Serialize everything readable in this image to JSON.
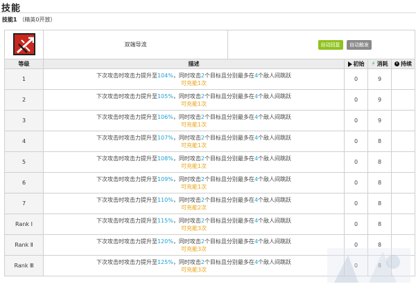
{
  "page": {
    "title": "技能",
    "skill_tag": "技能1",
    "skill_unlock": "（精英0开放）"
  },
  "skill": {
    "name": "双端导流",
    "icon": "skill-icon-red-arrows",
    "badge_recovery": "自动回复",
    "badge_trigger": "自动触发",
    "badge_recovery_color": "#8fc31f",
    "badge_trigger_color": "#8a8a8a"
  },
  "columns": {
    "level": "等级",
    "description": "描述",
    "initial": "初始",
    "cost": "消耗",
    "duration": "持续"
  },
  "rows": [
    {
      "level": "1",
      "pre": "下次攻击时攻击力提升至",
      "atk": "104%",
      "mid": "，同时攻击",
      "targets": "2",
      "mid2": "个目标且分别最多在",
      "enemies": "4",
      "post": "个敌人间跳跃",
      "charge": "可充能1次",
      "initial": "0",
      "cost": "9",
      "duration": ""
    },
    {
      "level": "2",
      "pre": "下次攻击时攻击力提升至",
      "atk": "105%",
      "mid": "，同时攻击",
      "targets": "2",
      "mid2": "个目标且分别最多在",
      "enemies": "4",
      "post": "个敌人间跳跃",
      "charge": "可充能1次",
      "initial": "0",
      "cost": "9",
      "duration": ""
    },
    {
      "level": "3",
      "pre": "下次攻击时攻击力提升至",
      "atk": "106%",
      "mid": "，同时攻击",
      "targets": "2",
      "mid2": "个目标且分别最多在",
      "enemies": "4",
      "post": "个敌人间跳跃",
      "charge": "可充能1次",
      "initial": "0",
      "cost": "9",
      "duration": ""
    },
    {
      "level": "4",
      "pre": "下次攻击时攻击力提升至",
      "atk": "107%",
      "mid": "，同时攻击",
      "targets": "2",
      "mid2": "个目标且分别最多在",
      "enemies": "4",
      "post": "个敌人间跳跃",
      "charge": "可充能1次",
      "initial": "0",
      "cost": "8",
      "duration": ""
    },
    {
      "level": "5",
      "pre": "下次攻击时攻击力提升至",
      "atk": "108%",
      "mid": "，同时攻击",
      "targets": "2",
      "mid2": "个目标且分别最多在",
      "enemies": "4",
      "post": "个敌人间跳跃",
      "charge": "可充能1次",
      "initial": "0",
      "cost": "8",
      "duration": ""
    },
    {
      "level": "6",
      "pre": "下次攻击时攻击力提升至",
      "atk": "109%",
      "mid": "，同时攻击",
      "targets": "2",
      "mid2": "个目标且分别最多在",
      "enemies": "4",
      "post": "个敌人间跳跃",
      "charge": "可充能1次",
      "initial": "0",
      "cost": "8",
      "duration": ""
    },
    {
      "level": "7",
      "pre": "下次攻击时攻击力提升至",
      "atk": "110%",
      "mid": "，同时攻击",
      "targets": "2",
      "mid2": "个目标且分别最多在",
      "enemies": "4",
      "post": "个敌人间跳跃",
      "charge": "可充能2次",
      "initial": "0",
      "cost": "8",
      "duration": ""
    },
    {
      "level": "Rank Ⅰ",
      "pre": "下次攻击时攻击力提升至",
      "atk": "115%",
      "mid": "，同时攻击",
      "targets": "2",
      "mid2": "个目标且分别最多在",
      "enemies": "4",
      "post": "个敌人间跳跃",
      "charge": "可充能3次",
      "initial": "0",
      "cost": "8",
      "duration": ""
    },
    {
      "level": "Rank Ⅱ",
      "pre": "下次攻击时攻击力提升至",
      "atk": "120%",
      "mid": "，同时攻击",
      "targets": "2",
      "mid2": "个目标且分别最多在",
      "enemies": "4",
      "post": "个敌人间跳跃",
      "charge": "可充能3次",
      "initial": "0",
      "cost": "8",
      "duration": ""
    },
    {
      "level": "Rank Ⅲ",
      "pre": "下次攻击时攻击力提升至",
      "atk": "125%",
      "mid": "，同时攻击",
      "targets": "2",
      "mid2": "个目标且分别最多在",
      "enemies": "4",
      "post": "个敌人间跳跃",
      "charge": "可充能3次",
      "initial": "0",
      "cost": "8",
      "duration": ""
    }
  ],
  "colors": {
    "highlight": "#1ba1d6",
    "charge": "#e8a317"
  }
}
